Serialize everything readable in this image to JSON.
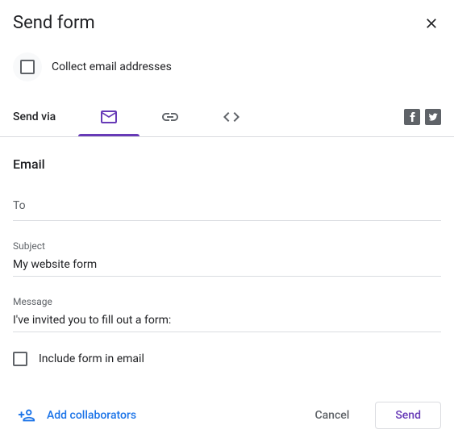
{
  "header": {
    "title": "Send form"
  },
  "collect": {
    "label": "Collect email addresses",
    "checked": false
  },
  "sendvia": {
    "label": "Send via",
    "tabs": [
      {
        "name": "email",
        "active": true
      },
      {
        "name": "link",
        "active": false
      },
      {
        "name": "embed",
        "active": false
      }
    ]
  },
  "section": {
    "title": "Email"
  },
  "fields": {
    "to": {
      "placeholder": "To",
      "value": ""
    },
    "subject": {
      "label": "Subject",
      "value": "My website form"
    },
    "message": {
      "label": "Message",
      "value": "I've invited you to fill out a form:"
    }
  },
  "include": {
    "label": "Include form in email",
    "checked": false
  },
  "footer": {
    "add_collaborators": "Add collaborators",
    "cancel": "Cancel",
    "send": "Send"
  }
}
